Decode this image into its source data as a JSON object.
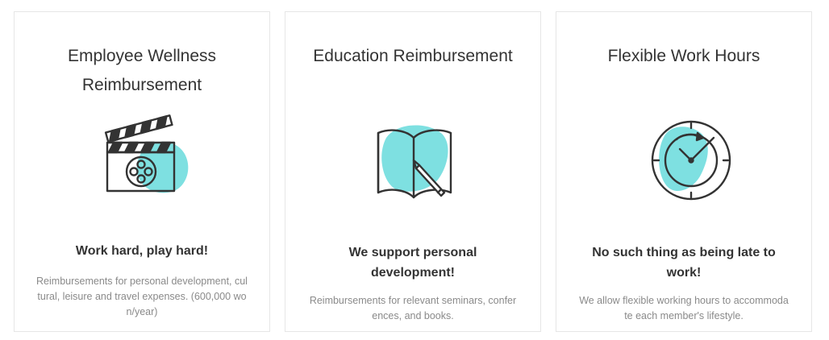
{
  "cards": [
    {
      "title": "Employee Wellness Reimbursement",
      "icon": "film-clapperboard-icon",
      "subtitle": "Work hard, play hard!",
      "description": "Reimbursements for personal development, cultural, leisure and travel expenses. (600,000 won/year)"
    },
    {
      "title": "Education Reimbursement",
      "icon": "open-book-pencil-icon",
      "subtitle": "We support personal development!",
      "description": "Reimbursements for relevant seminars, conferences, and books."
    },
    {
      "title": "Flexible Work Hours",
      "icon": "clock-icon",
      "subtitle": "No such thing as being late to work!",
      "description": "We allow flexible working hours to accommodate each member's lifestyle."
    }
  ],
  "colors": {
    "accent": "#7ee0e1",
    "line": "#333333",
    "muted_text": "#8a8a8a",
    "border": "#e6e6e6"
  }
}
